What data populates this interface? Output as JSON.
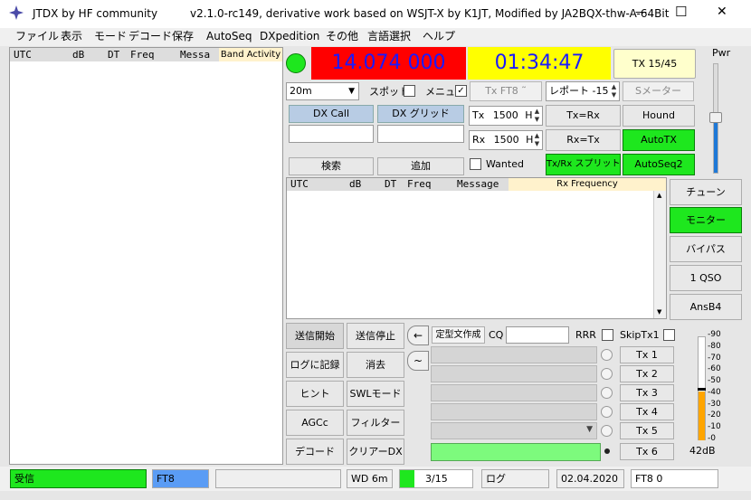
{
  "window": {
    "app_name": "JTDX  by HF community",
    "title": "v2.1.0-rc149, derivative work based on WSJT-X by K1JT,  Modified by JA2BQX-thw-A-64Bit",
    "minimize": "—",
    "maximize": "☐",
    "close": "✕"
  },
  "menu": [
    "ファイル",
    "表示",
    "モード",
    "デコード",
    "保存",
    "AutoSeq",
    "DXpedition",
    "その他",
    "言語選択",
    "ヘルプ"
  ],
  "band_activity": {
    "headers": {
      "utc": "UTC",
      "db": "dB",
      "dt": "DT",
      "freq": "Freq",
      "message": "Messa"
    },
    "title": "Band Activity"
  },
  "frequency": "14.074 000",
  "utc_clock": "01:34:47",
  "tx_period": "TX 15/45",
  "band": "20m",
  "spot_label": "スポット",
  "menu_label": "メニュー",
  "menu_checked": "✓",
  "tx_mode": "Tx FT8 ˜",
  "report": "レポート -15",
  "smeter": "Sメーター",
  "dx_call_label": "DX Call",
  "dx_grid_label": "DX グリッド",
  "tx_freq": {
    "prefix": "Tx",
    "value": "1500",
    "suffix": "H"
  },
  "rx_freq": {
    "prefix": "Rx",
    "value": "1500",
    "suffix": "H"
  },
  "tx_eq_rx": "Tx=Rx",
  "hound": "Hound",
  "rx_eq_tx": "Rx=Tx",
  "autotx": "AutoTX",
  "search": "検索",
  "add": "追加",
  "wanted": "Wanted",
  "txrx_split": "Tx/Rx スプリット",
  "autoseq2": "AutoSeq2",
  "rx_frequency": {
    "headers": {
      "utc": "UTC",
      "db": "dB",
      "dt": "DT",
      "freq": "Freq",
      "message": "Message"
    },
    "title": "Rx Frequency"
  },
  "side_buttons": [
    "チューン",
    "モニター",
    "バイパス",
    "1 QSO",
    "AnsB4"
  ],
  "pwr_label": "Pwr",
  "left_buttons": [
    [
      "送信開始",
      "送信停止"
    ],
    [
      "ログに記録",
      "消去"
    ],
    [
      "ヒント",
      "SWLモード"
    ],
    [
      "AGCc",
      "フィルター"
    ],
    [
      "デコード",
      "クリアーDX"
    ]
  ],
  "arrow_left": "←",
  "tilde": "~",
  "template_button": "定型文作成",
  "cq_label": "CQ",
  "rrr_label": "RRR",
  "skiptx1_label": "SkipTx1",
  "tx_buttons": [
    "Tx 1",
    "Tx 2",
    "Tx 3",
    "Tx 4",
    "Tx 5",
    "Tx 6"
  ],
  "meter": {
    "scale": [
      "90",
      "80",
      "70",
      "60",
      "50",
      "40",
      "30",
      "20",
      "10",
      "0"
    ],
    "readout": "42dB",
    "level_db": 42
  },
  "status": {
    "receive": "受信",
    "mode": "FT8",
    "wd": "WD 6m",
    "progress": "3/15",
    "log": "ログ",
    "date": "02.04.2020",
    "mode_count": "FT8  0"
  },
  "colors": {
    "freq_bg": "#ff0000",
    "freq_fg": "#1a1aff",
    "clock_bg": "#ffff00",
    "green": "#1ee71e",
    "orange_bar": "#ffa500",
    "blue_status": "#5a9cf5"
  }
}
